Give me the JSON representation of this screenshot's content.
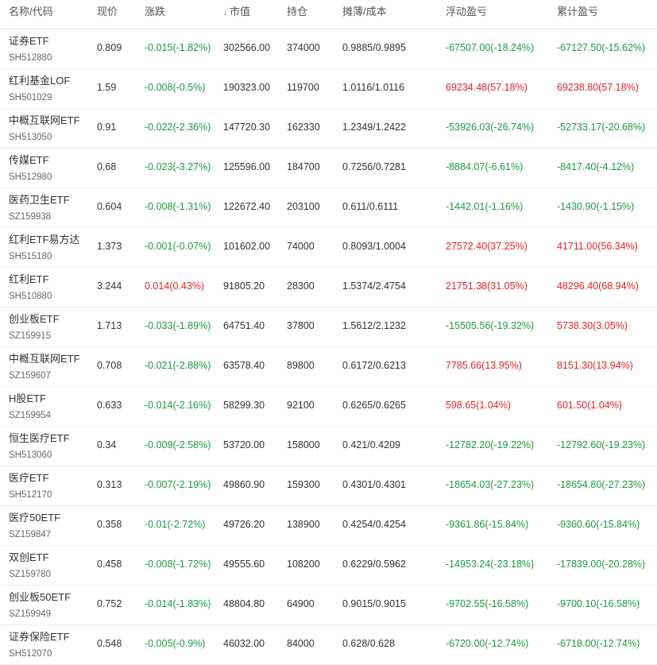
{
  "header": {
    "name_code": "名称/代码",
    "price": "现价",
    "change": "涨跌",
    "market_value": "市值",
    "position": "持仓",
    "cost": "摊薄/成本",
    "floating_pnl": "浮动盈亏",
    "cumulative_pnl": "累计盈亏",
    "sort_icon": "arrow-down-icon",
    "sort_glyph": "↓"
  },
  "colors": {
    "up": "#e02424",
    "down": "#1a9a3a",
    "sort": "#1677ff"
  },
  "rows": [
    {
      "name": "证券ETF",
      "code": "SH512880",
      "price": "0.809",
      "change": "-0.015(-1.82%)",
      "change_dir": "down",
      "value": "302566.00",
      "qty": "374000",
      "cost": "0.9885/0.9895",
      "float": "-67507.00(-18.24%)",
      "float_dir": "down",
      "cum": "-67127.50(-15.62%)",
      "cum_dir": "down"
    },
    {
      "name": "红利基金LOF",
      "code": "SH501029",
      "price": "1.59",
      "change": "-0.008(-0.5%)",
      "change_dir": "down",
      "value": "190323.00",
      "qty": "119700",
      "cost": "1.0116/1.0116",
      "float": "69234.48(57.18%)",
      "float_dir": "up",
      "cum": "69238.80(57.18%)",
      "cum_dir": "up"
    },
    {
      "name": "中概互联网ETF",
      "code": "SH513050",
      "price": "0.91",
      "change": "-0.022(-2.36%)",
      "change_dir": "down",
      "value": "147720.30",
      "qty": "162330",
      "cost": "1.2349/1.2422",
      "float": "-53926.03(-26.74%)",
      "float_dir": "down",
      "cum": "-52733.17(-20.68%)",
      "cum_dir": "down"
    },
    {
      "name": "传媒ETF",
      "code": "SH512980",
      "price": "0.68",
      "change": "-0.023(-3.27%)",
      "change_dir": "down",
      "value": "125596.00",
      "qty": "184700",
      "cost": "0.7256/0.7281",
      "float": "-8884.07(-6.61%)",
      "float_dir": "down",
      "cum": "-8417.40(-4.12%)",
      "cum_dir": "down"
    },
    {
      "name": "医药卫生ETF",
      "code": "SZ159938",
      "price": "0.604",
      "change": "-0.008(-1.31%)",
      "change_dir": "down",
      "value": "122672.40",
      "qty": "203100",
      "cost": "0.611/0.6111",
      "float": "-1442.01(-1.16%)",
      "float_dir": "down",
      "cum": "-1430.90(-1.15%)",
      "cum_dir": "down"
    },
    {
      "name": "红利ETF易方达",
      "code": "SH515180",
      "price": "1.373",
      "change": "-0.001(-0.07%)",
      "change_dir": "down",
      "value": "101602.00",
      "qty": "74000",
      "cost": "0.8093/1.0004",
      "float": "27572.40(37.25%)",
      "float_dir": "up",
      "cum": "41711.00(56.34%)",
      "cum_dir": "up"
    },
    {
      "name": "红利ETF",
      "code": "SH510880",
      "price": "3.244",
      "change": "0.014(0.43%)",
      "change_dir": "up",
      "value": "91805.20",
      "qty": "28300",
      "cost": "1.5374/2.4754",
      "float": "21751.38(31.05%)",
      "float_dir": "up",
      "cum": "48296.40(68.94%)",
      "cum_dir": "up"
    },
    {
      "name": "创业板ETF",
      "code": "SZ159915",
      "price": "1.713",
      "change": "-0.033(-1.89%)",
      "change_dir": "down",
      "value": "64751.40",
      "qty": "37800",
      "cost": "1.5612/2.1232",
      "float": "-15505.56(-19.32%)",
      "float_dir": "down",
      "cum": "5738.30(3.05%)",
      "cum_dir": "up"
    },
    {
      "name": "中概互联网ETF",
      "code": "SZ159607",
      "price": "0.708",
      "change": "-0.021(-2.88%)",
      "change_dir": "down",
      "value": "63578.40",
      "qty": "89800",
      "cost": "0.6172/0.6213",
      "float": "7785.66(13.95%)",
      "float_dir": "up",
      "cum": "8151.30(13.94%)",
      "cum_dir": "up"
    },
    {
      "name": "H股ETF",
      "code": "SZ159954",
      "price": "0.633",
      "change": "-0.014(-2.16%)",
      "change_dir": "down",
      "value": "58299.30",
      "qty": "92100",
      "cost": "0.6265/0.6265",
      "float": "598.65(1.04%)",
      "float_dir": "up",
      "cum": "601.50(1.04%)",
      "cum_dir": "up"
    },
    {
      "name": "恒生医疗ETF",
      "code": "SH513060",
      "price": "0.34",
      "change": "-0.009(-2.58%)",
      "change_dir": "down",
      "value": "53720.00",
      "qty": "158000",
      "cost": "0.421/0.4209",
      "float": "-12782.20(-19.22%)",
      "float_dir": "down",
      "cum": "-12792.60(-19.23%)",
      "cum_dir": "down"
    },
    {
      "name": "医疗ETF",
      "code": "SH512170",
      "price": "0.313",
      "change": "-0.007(-2.19%)",
      "change_dir": "down",
      "value": "49860.90",
      "qty": "159300",
      "cost": "0.4301/0.4301",
      "float": "-18654.03(-27.23%)",
      "float_dir": "down",
      "cum": "-18654.80(-27.23%)",
      "cum_dir": "down"
    },
    {
      "name": "医疗50ETF",
      "code": "SZ159847",
      "price": "0.358",
      "change": "-0.01(-2.72%)",
      "change_dir": "down",
      "value": "49726.20",
      "qty": "138900",
      "cost": "0.4254/0.4254",
      "float": "-9361.86(-15.84%)",
      "float_dir": "down",
      "cum": "-9360.60(-15.84%)",
      "cum_dir": "down"
    },
    {
      "name": "双创ETF",
      "code": "SZ159780",
      "price": "0.458",
      "change": "-0.008(-1.72%)",
      "change_dir": "down",
      "value": "49555.60",
      "qty": "108200",
      "cost": "0.6229/0.5962",
      "float": "-14953.24(-23.18%)",
      "float_dir": "down",
      "cum": "-17839.00(-20.28%)",
      "cum_dir": "down"
    },
    {
      "name": "创业板50ETF",
      "code": "SZ159949",
      "price": "0.752",
      "change": "-0.014(-1.83%)",
      "change_dir": "down",
      "value": "48804.80",
      "qty": "64900",
      "cost": "0.9015/0.9015",
      "float": "-9702.55(-16.58%)",
      "float_dir": "down",
      "cum": "-9700.10(-16.58%)",
      "cum_dir": "down"
    },
    {
      "name": "证券保险ETF",
      "code": "SH512070",
      "price": "0.548",
      "change": "-0.005(-0.9%)",
      "change_dir": "down",
      "value": "46032.00",
      "qty": "84000",
      "cost": "0.628/0.628",
      "float": "-6720.00(-12.74%)",
      "float_dir": "down",
      "cum": "-6718.00(-12.74%)",
      "cum_dir": "down"
    }
  ]
}
